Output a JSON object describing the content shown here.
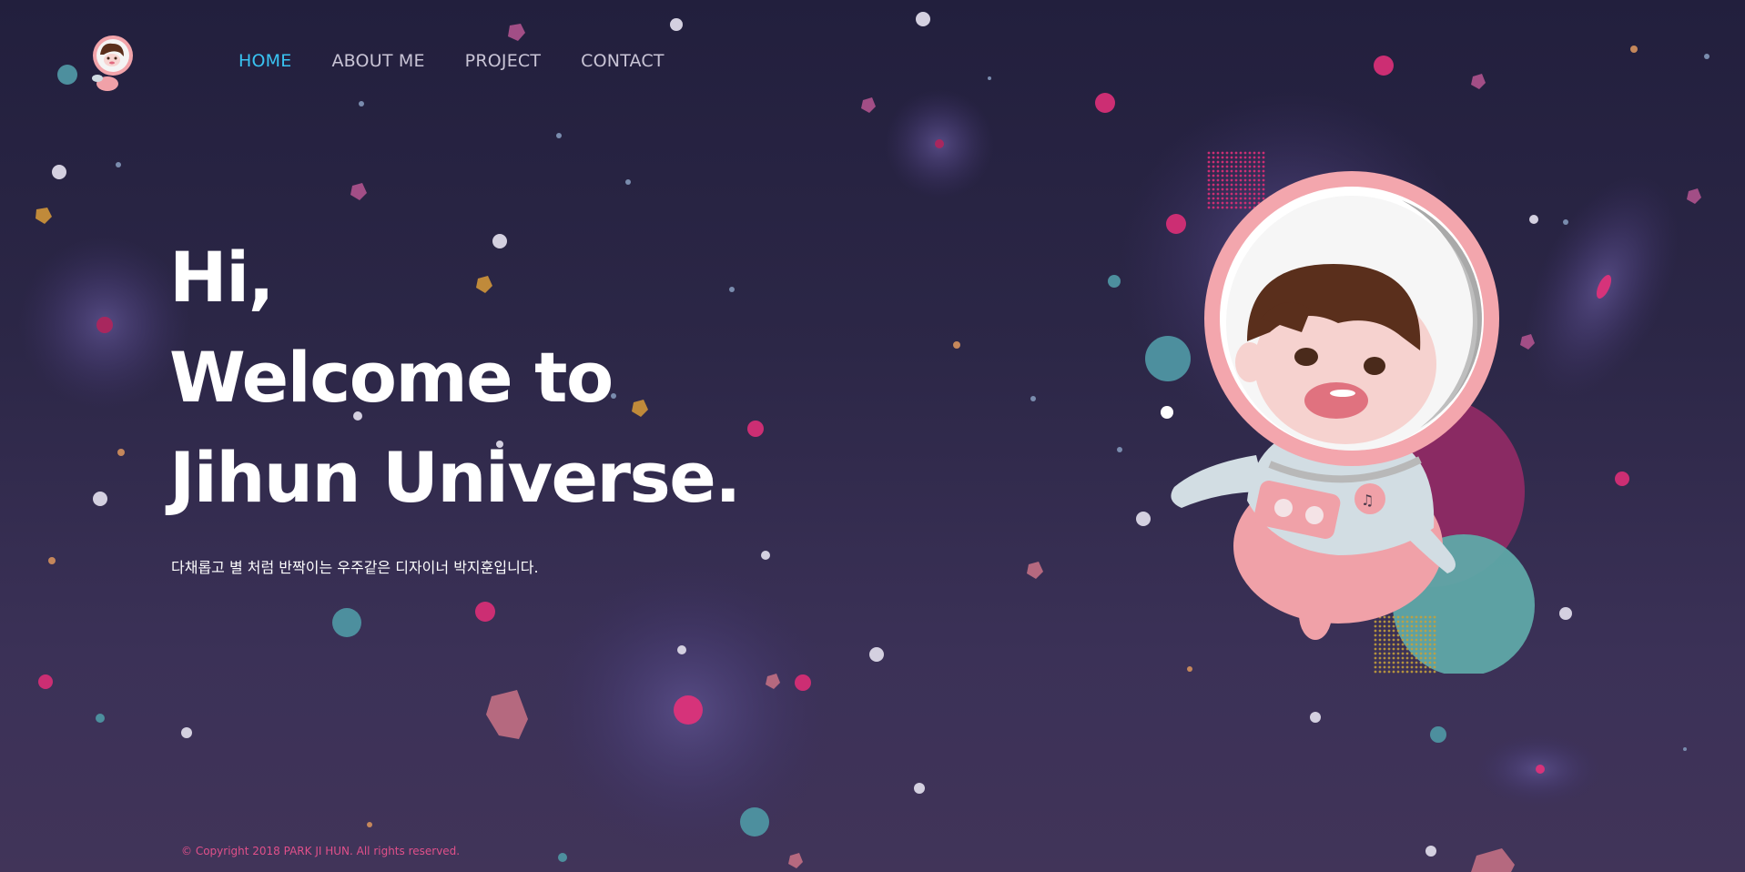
{
  "nav": {
    "items": [
      {
        "label": "HOME",
        "active": true
      },
      {
        "label": "ABOUT ME",
        "active": false
      },
      {
        "label": "PROJECT",
        "active": false
      },
      {
        "label": "CONTACT",
        "active": false
      }
    ]
  },
  "hero": {
    "line1": "Hi,",
    "line2": "Welcome to",
    "line3": "Jihun Universe.",
    "subtitle": "다채롭고 별 처럼 반짝이는 우주같은 디자이너 박지훈입니다."
  },
  "footer": {
    "copyright": "© Copyright 2018 PARK JI HUN. All rights reserved."
  },
  "icons": {
    "logo": "astronaut-logo-icon",
    "illustration": "astronaut-illustration"
  },
  "colors": {
    "background_top": "#221f3d",
    "background_bottom": "#413459",
    "nav_active": "#39c3f2",
    "nav_text": "#c9c4d6",
    "copyright": "#e0508a",
    "accent_pink": "#d6337a",
    "accent_teal": "#4a9aa3"
  }
}
